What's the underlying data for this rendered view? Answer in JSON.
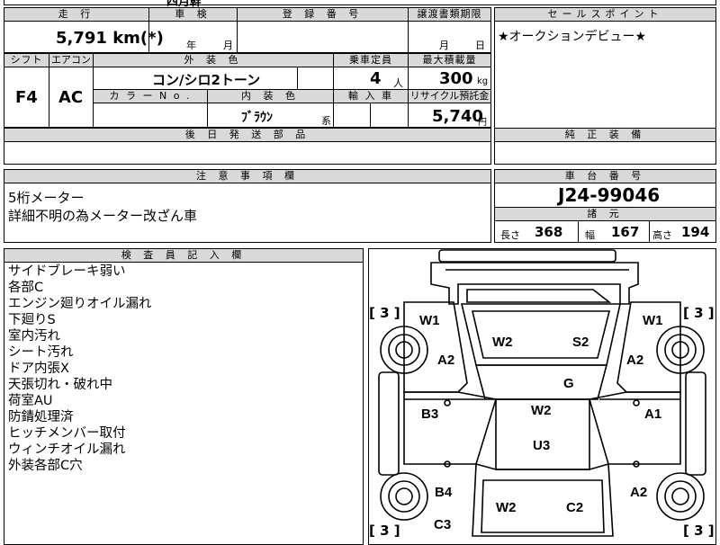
{
  "top_remnant": "四月幹",
  "vehicle_info": {
    "headers": {
      "mileage": "走 行",
      "shaken": "車 検",
      "registration": "登 録 番 号",
      "transfer_deadline": "譲渡書類期限",
      "shift": "シフト",
      "aircon": "エアコン",
      "exterior_color": "外 装 色",
      "capacity": "乗車定員",
      "max_load": "最大積載量",
      "color_no": "カ ラ ー N o .",
      "interior_color": "内 装 色",
      "import": "輸 入 車",
      "recycle": "リサイクル預託金",
      "dispatch_parts": "後 日 発 送 部 品"
    },
    "mileage": "5,791 km(*)",
    "shaken_year": "年",
    "shaken_month": "月",
    "transfer_month": "月",
    "transfer_day": "日",
    "shift": "F4",
    "aircon": "AC",
    "exterior_color": "コン/シロ2トーン",
    "capacity": "4",
    "capacity_unit": "人",
    "max_load": "300",
    "max_load_unit": "kg",
    "interior_color": "ﾌﾞﾗｳﾝ",
    "interior_suffix": "系",
    "recycle_fee": "5,740",
    "recycle_unit": "円"
  },
  "sales_point": {
    "header": "セールスポイント",
    "text": "★オークションデビュー★"
  },
  "genuine_equipment": {
    "header": "純 正 装 備"
  },
  "notes": {
    "header": "注 意 事 項 欄",
    "lines": [
      "5桁メーター",
      "詳細不明の為メーター改ざん車"
    ]
  },
  "chassis": {
    "header": "車 台 番 号",
    "number": "J24-99046",
    "dims_header": "諸 元",
    "length_label": "長さ",
    "length": "368",
    "width_label": "幅",
    "width": "167",
    "height_label": "高さ",
    "height": "194"
  },
  "inspector": {
    "header": "検 査 員 記 入 欄",
    "lines": [
      "サイドブレーキ弱い",
      "各部C",
      "エンジン廻りオイル漏れ",
      "下廻りS",
      "室内汚れ",
      "シート汚れ",
      "ドア内張X",
      "天張切れ・破れ中",
      "荷室AU",
      "防錆処理済",
      "ヒッチメンバー取付",
      "ウィンチオイル漏れ",
      "外装各部C穴"
    ]
  },
  "diagram": {
    "labels": {
      "w1_left": "W1",
      "w1_right": "W1",
      "w2_front": "W2",
      "s2": "S2",
      "a2_left_front": "A2",
      "a2_right_front": "A2",
      "g": "G",
      "b3": "B3",
      "a1": "A1",
      "w2_center": "W2",
      "u3": "U3",
      "b4": "B4",
      "a2_right_rear": "A2",
      "w2_rear": "W2",
      "c2": "C2",
      "c3": "C3"
    },
    "tires": {
      "front_left": "[ 3 ]",
      "front_right": "[ 3 ]",
      "rear_left": "[ 3 ]",
      "rear_right": "[ 3 ]"
    }
  }
}
